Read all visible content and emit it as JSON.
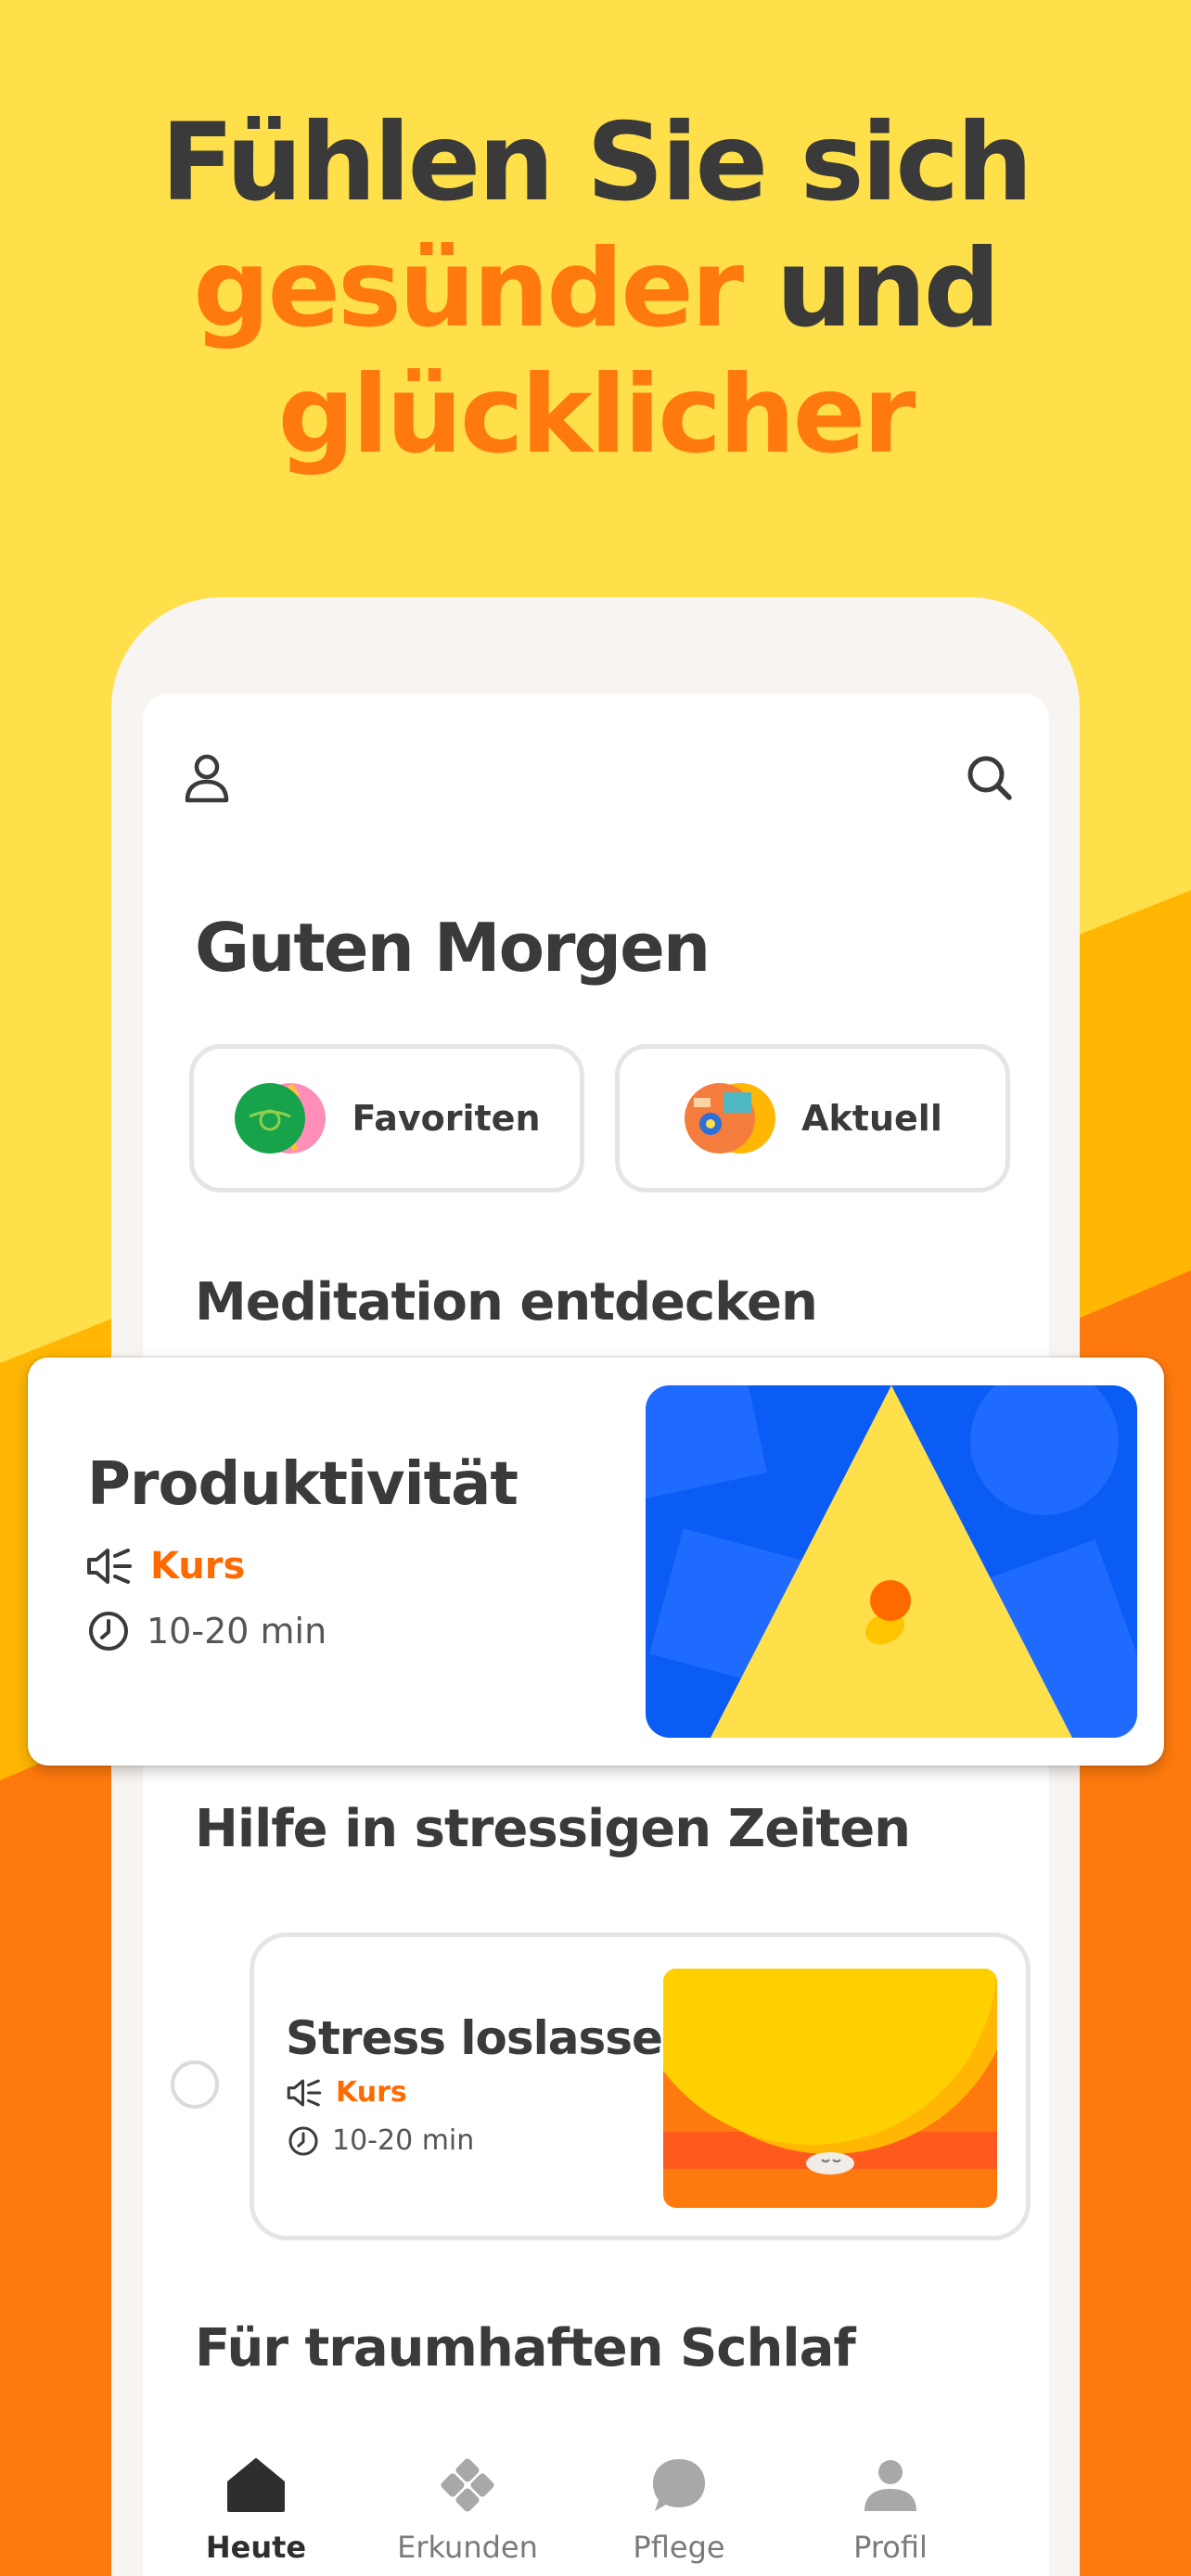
{
  "colors": {
    "background_yellow": "#FFE04B",
    "band_amber": "#FFB703",
    "band_orange": "#FF7A0E",
    "accent_orange": "#FF6A00",
    "text_dark": "#3A3A3A"
  },
  "headline": {
    "line1": "Fühlen Sie sich",
    "line2_accent": "gesünder",
    "line2_rest": "und",
    "line3_accent": "glücklicher"
  },
  "top_bar": {
    "left_icon": "user-icon",
    "right_icon": "search-icon"
  },
  "greeting": "Guten Morgen",
  "chips": [
    {
      "label": "Favoriten",
      "icon": "favorites-illustration"
    },
    {
      "label": "Aktuell",
      "icon": "recent-illustration"
    }
  ],
  "sections": {
    "discover": "Meditation entdecken",
    "stress": "Hilfe in stressigen Zeiten",
    "sleep": "Für traumhaften Schlaf"
  },
  "featured": {
    "title": "Produktivität",
    "type": "Kurs",
    "duration": "10-20 min",
    "type_icon": "speaker-icon",
    "duration_icon": "clock-icon"
  },
  "stress_item": {
    "title": "Stress loslassen",
    "type": "Kurs",
    "duration": "10-20 min",
    "type_icon": "speaker-icon",
    "duration_icon": "clock-icon"
  },
  "tabs": [
    {
      "label": "Heute",
      "icon": "home-icon",
      "active": true
    },
    {
      "label": "Erkunden",
      "icon": "explore-icon",
      "active": false
    },
    {
      "label": "Pflege",
      "icon": "chat-bubble-icon",
      "active": false
    },
    {
      "label": "Profil",
      "icon": "profile-icon",
      "active": false
    }
  ]
}
